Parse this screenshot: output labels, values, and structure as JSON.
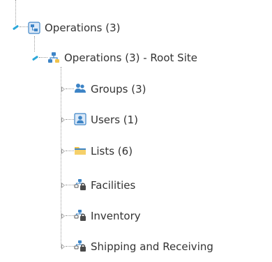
{
  "tree": {
    "items": [
      {
        "label": "Operations (3)",
        "icon": "folder-site-icon"
      },
      {
        "label": "Operations (3) - Root Site",
        "icon": "root-site-icon"
      },
      {
        "label": "Groups (3)",
        "icon": "groups-icon"
      },
      {
        "label": "Users (1)",
        "icon": "users-icon"
      },
      {
        "label": "Lists (6)",
        "icon": "lists-icon"
      },
      {
        "label": "Facilities",
        "icon": "locked-site-icon"
      },
      {
        "label": "Inventory",
        "icon": "locked-site-icon"
      },
      {
        "label": "Shipping and Receiving",
        "icon": "locked-site-icon"
      }
    ]
  },
  "colors": {
    "connector": "#9a9a9a",
    "pin": "#2aa7d9",
    "site_blue": "#3d84c6",
    "folder_yellow": "#f1c34c"
  }
}
